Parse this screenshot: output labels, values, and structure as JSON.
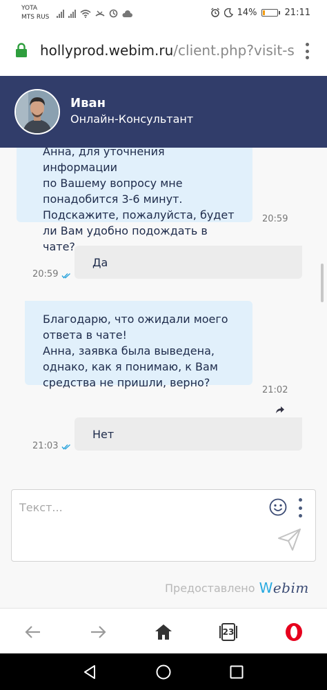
{
  "status_bar": {
    "carrier_line1": "YOTA",
    "carrier_line2": "MTS RUS",
    "battery_percent": "14%",
    "battery_level": 0.14,
    "battery_color": "#f39c12",
    "time": "21:11"
  },
  "browser": {
    "url_host": "hollyprod.webim.ru",
    "url_path": "/client.php?visit-se",
    "tabs_count": "23"
  },
  "chat_header": {
    "agent_name": "Иван",
    "agent_role": "Онлайн-Консультант",
    "background": "#313d6a"
  },
  "messages": [
    {
      "direction": "incoming",
      "text": "Анна, для уточнения информации\nпо Вашему вопросу мне\nпонадобится 3-6 минут.\nПодскажите, пожалуйста, будет\nли Вам удобно подождать в чате?",
      "time": "20:59"
    },
    {
      "direction": "outgoing",
      "text": "Да",
      "time": "20:59",
      "read": true
    },
    {
      "direction": "incoming",
      "text": "Благодарю, что ожидали моего\nответа в чате!\nАнна, заявка была выведена,\nоднако, как я понимаю, к Вам\nсредства не пришли, верно?",
      "time": "21:02"
    },
    {
      "direction": "outgoing",
      "text": "Нет",
      "time": "21:03",
      "read": true
    }
  ],
  "input": {
    "placeholder": "Текст..."
  },
  "footer": {
    "powered_label": "Предоставлено",
    "logo_w": "W",
    "logo_rest": "ebim"
  },
  "icons": {
    "lock": "lock-icon",
    "menu": "more-vertical-icon",
    "emoji": "smile-icon",
    "send": "paper-plane-icon",
    "forward": "forward-arrow-icon",
    "read_receipt": "double-check-icon",
    "back": "arrow-left-icon",
    "next": "arrow-right-icon",
    "home": "home-icon",
    "tabs": "tabs-icon",
    "opera": "opera-logo",
    "nav_back": "triangle-back-icon",
    "nav_home": "circle-home-icon",
    "nav_recents": "square-recents-icon"
  },
  "colors": {
    "incoming_bubble": "#e1f0fb",
    "outgoing_bubble": "#ececec",
    "check_color": "#2aa4dc",
    "accent_blue": "#27a9e0"
  }
}
